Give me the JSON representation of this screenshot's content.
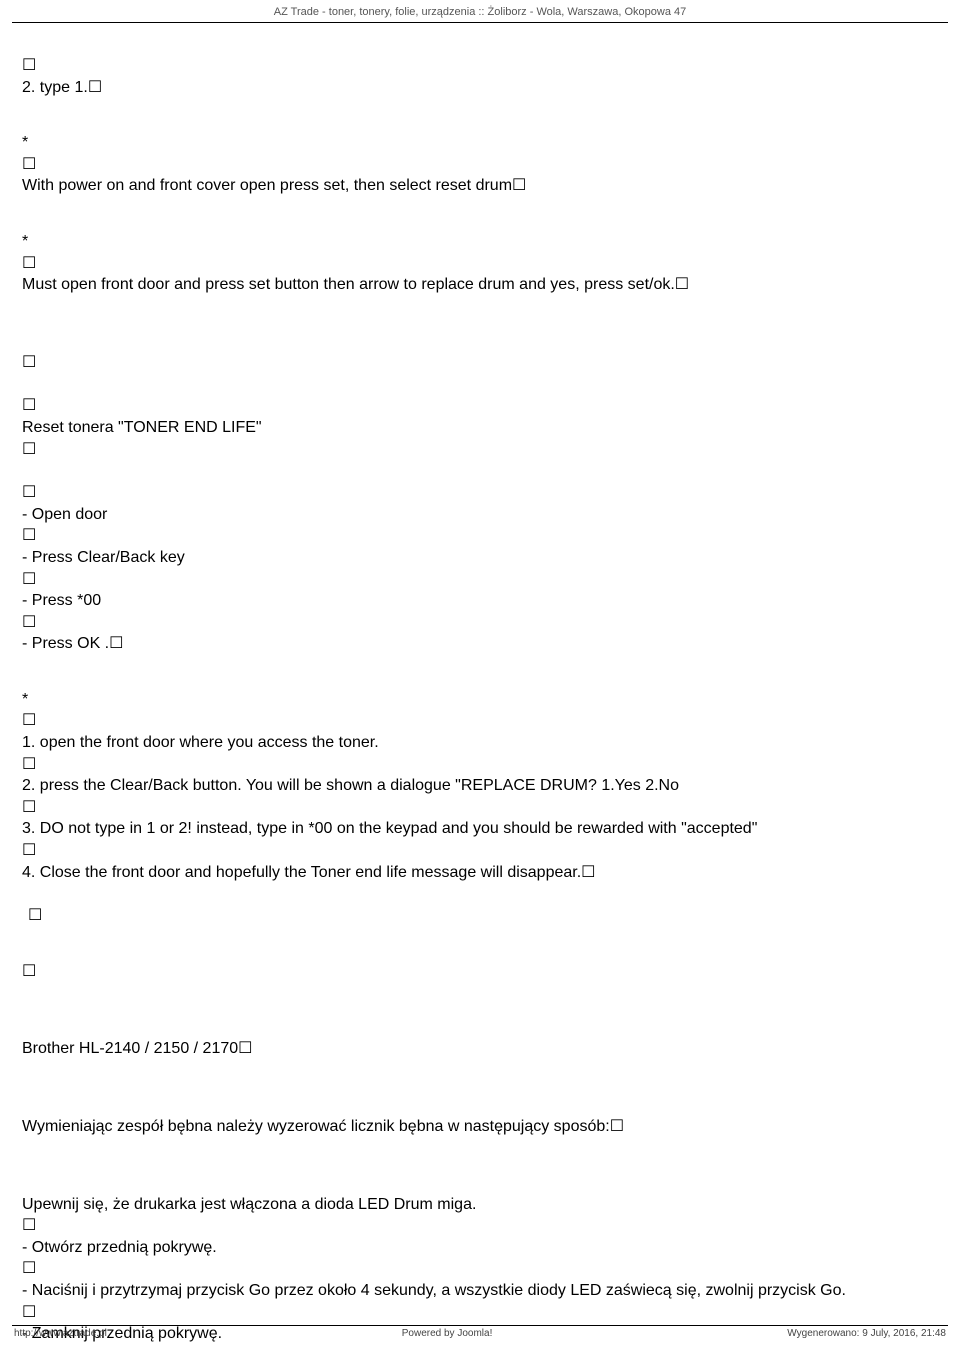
{
  "header": {
    "title": "AZ Trade - toner, tonery, folie, urządzenia :: Żoliborz - Wola, Warszawa, Okopowa 47"
  },
  "glyph": {
    "box": "☐"
  },
  "lines": {
    "l1": "2. type 1.☐",
    "l2": "*",
    "l3": "With power on and front cover open press set, then select reset drum☐",
    "l4": "*",
    "l5": "Must open front door and press set button then arrow to replace drum and yes, press set/ok.☐",
    "l6": "Reset tonera \"TONER END LIFE\"",
    "l7": "- Open door",
    "l8": "- Press Clear/Back key",
    "l9": "- Press *00",
    "l10": "- Press OK .☐",
    "l11": "*",
    "l12": "1. open the front door where you access the toner.",
    "l13": "2. press the Clear/Back button. You will be shown a dialogue \"REPLACE DRUM? 1.Yes 2.No",
    "l14": "3. DO not type in 1 or 2! instead, type in *00 on the keypad and you should be rewarded with \"accepted\"",
    "l15": "4. Close the front door and hopefully the Toner end life message will disappear.☐",
    "l16": "Brother HL-2140 / 2150 / 2170☐",
    "l17": "Wymieniając zespół bębna należy wyzerować licznik bębna w następujący sposób:☐",
    "l18": "Upewnij się, że drukarka jest włączona a dioda LED Drum miga.",
    "l19": "- Otwórz przednią pokrywę.",
    "l20": "- Naciśnij i przytrzymaj przycisk Go przez około 4 sekundy, a wszystkie diody LED zaświecą się, zwolnij przycisk Go.",
    "l21": "- Zamknij przednią pokrywę."
  },
  "footer": {
    "left": "http://www.aztrade.pl",
    "center": "Powered by Joomla!",
    "right": "Wygenerowano: 9 July, 2016, 21:48"
  }
}
